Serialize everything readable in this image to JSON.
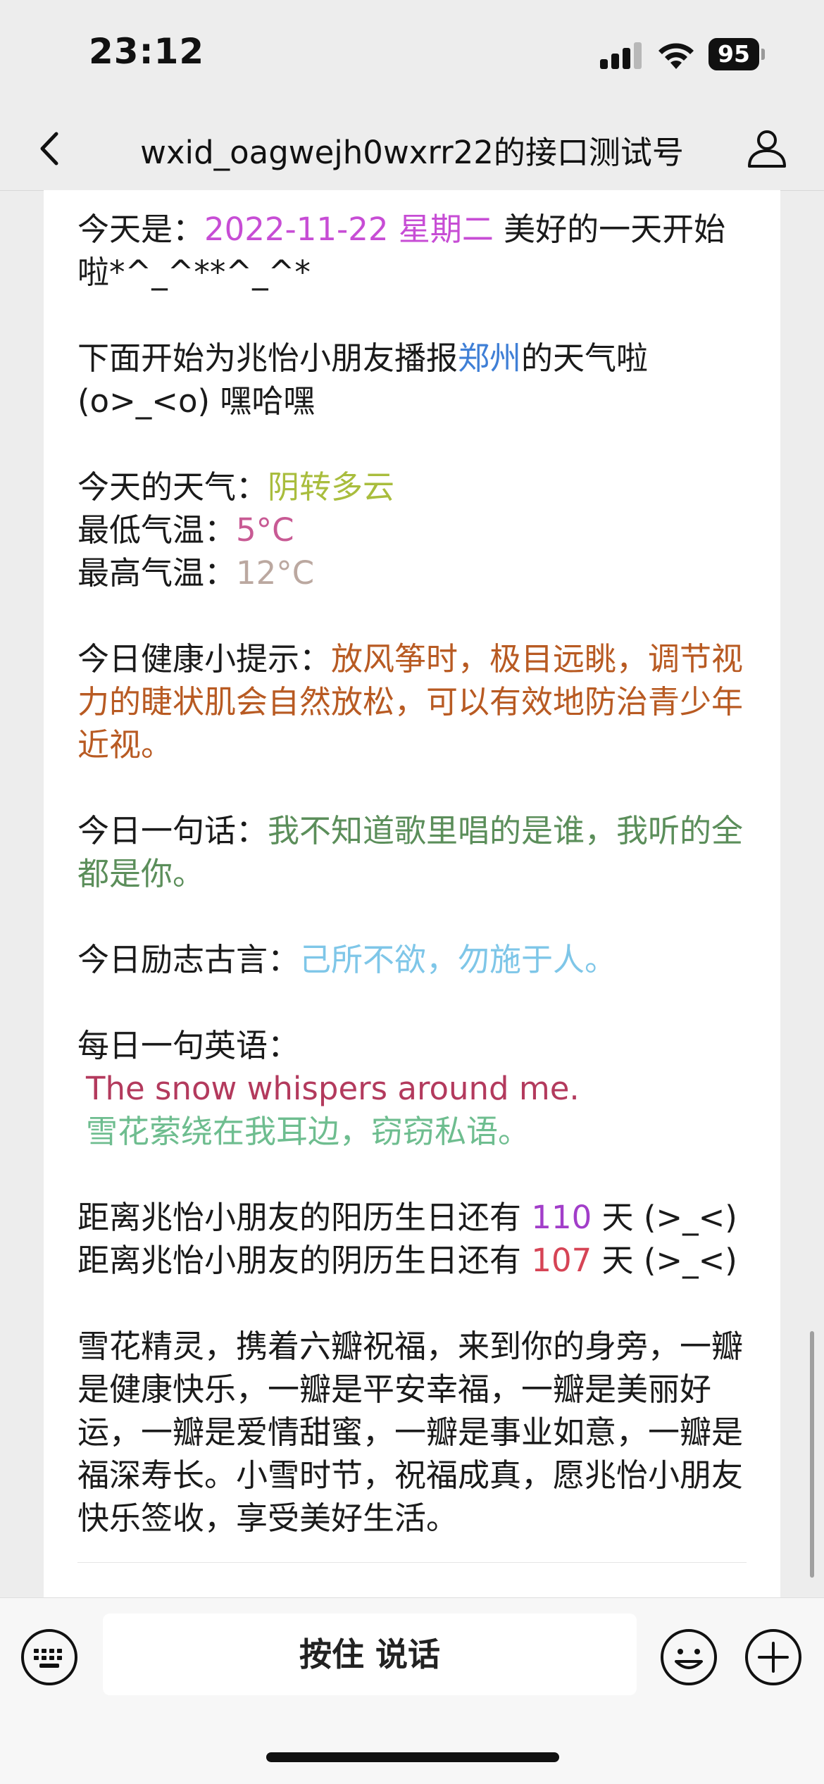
{
  "status": {
    "time": "23:12",
    "battery": "95"
  },
  "nav": {
    "title": "wxid_oagwejh0wxrr22的接口测试号"
  },
  "message": {
    "today_prefix": "今天是：",
    "date": "2022-11-22 星期二",
    "today_suffix": " 美好的一天开始啦*^_^**^_^*",
    "report_prefix": "下面开始为兆怡小朋友播报",
    "city": "郑州",
    "report_suffix": "的天气啦(o>_<o) 嘿哈嘿",
    "weather_label": "今天的天气：",
    "weather": "阴转多云",
    "low_label": "最低气温：",
    "low": "5°C",
    "high_label": "最高气温：",
    "high": "12°C",
    "tip_label": "今日健康小提示：",
    "tip": "放风筝时，极目远眺，调节视力的睫状肌会自然放松，可以有效地防治青少年近视。",
    "line_label": "今日一句话：",
    "line": "我不知道歌里唱的是谁，我听的全都是你。",
    "quote_label": "今日励志古言：",
    "quote": "己所不欲，勿施于人。",
    "english_label": "每日一句英语：",
    "english": "The snow whispers around me.",
    "english_cn": "雪花萦绕在我耳边，窃窃私语。",
    "solar_prefix": "距离兆怡小朋友的阳历生日还有 ",
    "solar_days": "110",
    "solar_suffix": " 天 (>_<)",
    "lunar_prefix": "距离兆怡小朋友的阴历生日还有 ",
    "lunar_days": "107",
    "lunar_suffix": " 天 (>_<)",
    "closing": "雪花精灵，携着六瓣祝福，来到你的身旁，一瓣是健康快乐，一瓣是平安幸福，一瓣是美丽好运，一瓣是爱情甜蜜，一瓣是事业如意，一瓣是福深寿长。小雪时节，祝福成真，愿兆怡小朋友快乐签收，享受美好生活。"
  },
  "input": {
    "hold_to_talk": "按住 说话"
  }
}
